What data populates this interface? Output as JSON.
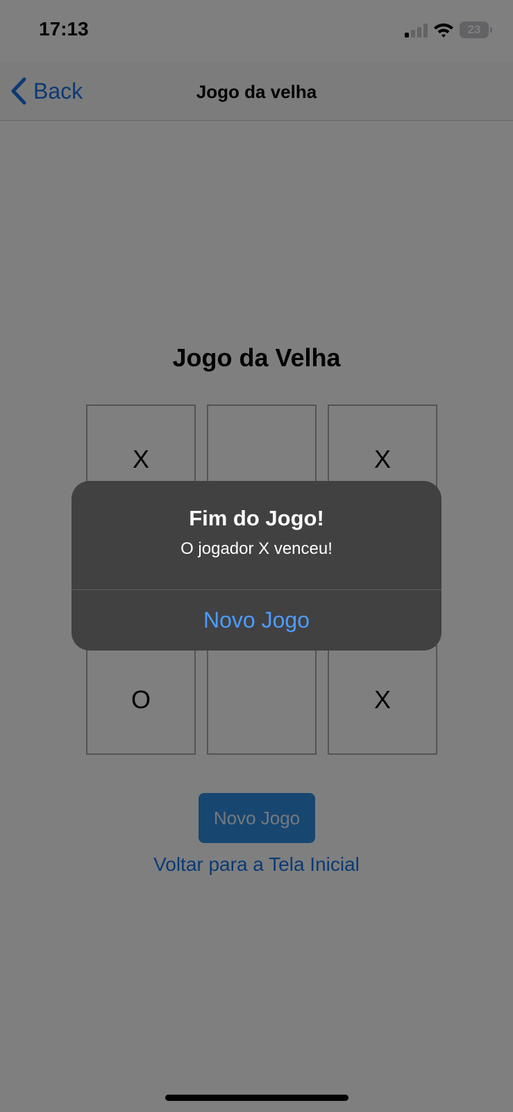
{
  "status_bar": {
    "time": "17:13",
    "battery": "23",
    "signal_bars_active": 1,
    "signal_bars_total": 4
  },
  "nav": {
    "back_label": "Back",
    "title": "Jogo da velha"
  },
  "game": {
    "title": "Jogo da Velha",
    "board": [
      "X",
      "",
      "X",
      "",
      "",
      "",
      "O",
      "",
      "X"
    ]
  },
  "actions": {
    "new_game_label": "Novo Jogo",
    "home_link_label": "Voltar para a Tela Inicial"
  },
  "alert": {
    "title": "Fim do Jogo!",
    "message": "O jogador X venceu!",
    "button_label": "Novo Jogo"
  },
  "colors": {
    "accent": "#1674e8",
    "button_bg": "#2e8ee3",
    "alert_bg": "#414141",
    "alert_button": "#4d9bff"
  }
}
